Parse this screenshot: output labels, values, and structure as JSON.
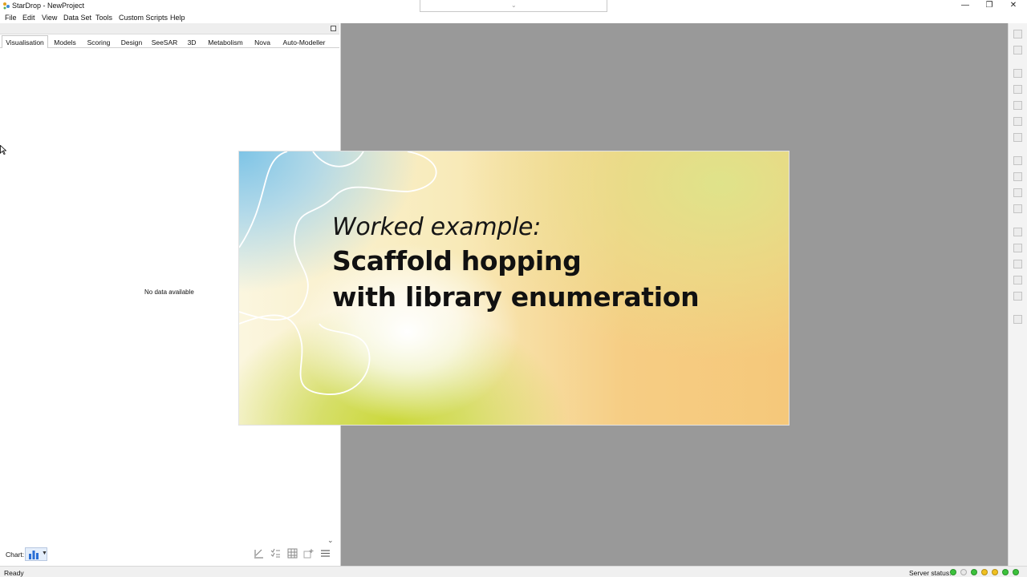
{
  "window": {
    "title": "StarDrop - NewProject",
    "minimize_glyph": "—",
    "restore_glyph": "❐",
    "close_glyph": "✕"
  },
  "menu": [
    "File",
    "Edit",
    "View",
    "Data Set",
    "Tools",
    "Custom Scripts",
    "Help"
  ],
  "tabs": [
    "Visualisation",
    "Models",
    "Scoring",
    "Design",
    "SeeSAR",
    "3D",
    "Metabolism",
    "Nova",
    "Auto-Modeller"
  ],
  "active_tab": "Visualisation",
  "left_panel": {
    "empty_message": "No data available",
    "chart_label": "Chart:",
    "chart_type_icon": "bar-chart-icon"
  },
  "overlay": {
    "subtitle": "Worked example:",
    "title_line1": "Scaffold hopping",
    "title_line2": "with library enumeration"
  },
  "statusbar": {
    "status": "Ready",
    "server_label": "Server status:",
    "server_lights": [
      "#3cc23c",
      "#e8e8e8",
      "#3cc23c",
      "#f0c020",
      "#f0c020",
      "#3cc23c",
      "#3cc23c",
      "#e0e0e0"
    ]
  },
  "colors": {
    "main_bg": "#999999",
    "accent": "#2a6fd6"
  }
}
